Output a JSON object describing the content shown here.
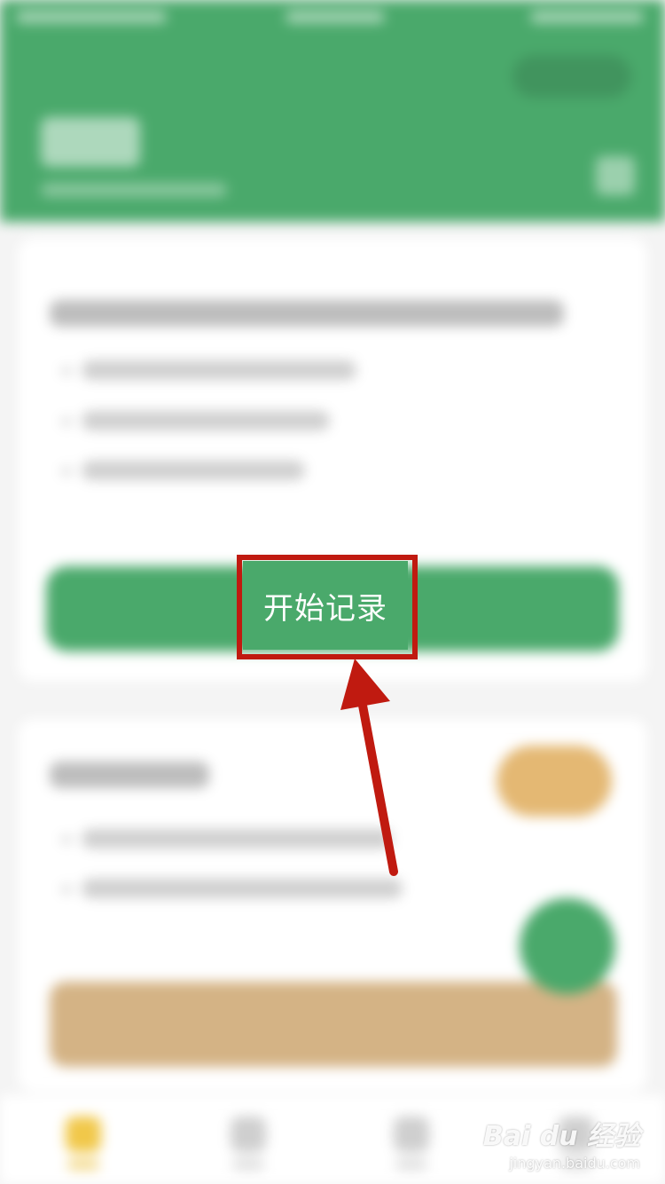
{
  "main": {
    "start_record_button": "开始记录"
  },
  "watermark": {
    "brand": "Bai du 经验",
    "url": "jingyan.baidu.com"
  },
  "colors": {
    "accent_green": "#4aa96b",
    "highlight_red": "#c01a10",
    "tan_button": "#d4b385"
  },
  "icons": {
    "fab": "plus-icon",
    "annotation": "arrow-icon"
  }
}
